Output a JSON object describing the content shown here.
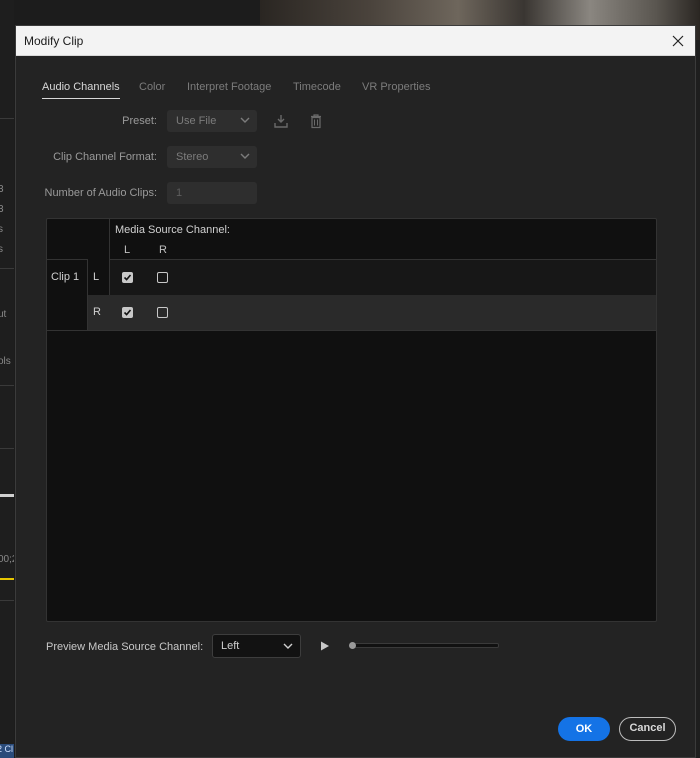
{
  "background": {
    "left_fragments": [
      "3",
      "3",
      "s",
      "s",
      "ut",
      "ols",
      "00;2",
      "2 Cl"
    ]
  },
  "dialog": {
    "title": "Modify Clip",
    "close_icon": "close-icon",
    "tabs": [
      {
        "label": "Audio Channels",
        "active": true
      },
      {
        "label": "Color",
        "active": false
      },
      {
        "label": "Interpret Footage",
        "active": false
      },
      {
        "label": "Timecode",
        "active": false
      },
      {
        "label": "VR Properties",
        "active": false
      }
    ],
    "preset": {
      "label": "Preset:",
      "value": "Use File",
      "save_icon": "save-preset-icon",
      "delete_icon": "trash-icon"
    },
    "clip_channel_format": {
      "label": "Clip Channel Format:",
      "value": "Stereo"
    },
    "num_audio_clips": {
      "label": "Number of Audio Clips:",
      "value": "1"
    },
    "matrix": {
      "header": "Media Source Channel:",
      "columns": [
        "L",
        "R"
      ],
      "clips": [
        {
          "name": "Clip 1",
          "rows": [
            {
              "channel": "L",
              "checks": [
                true,
                false
              ]
            },
            {
              "channel": "R",
              "checks": [
                true,
                false
              ]
            }
          ]
        }
      ]
    },
    "preview": {
      "label": "Preview Media Source Channel:",
      "value": "Left",
      "play_icon": "play-icon",
      "position": 0.0
    },
    "buttons": {
      "ok": "OK",
      "cancel": "Cancel"
    },
    "colors": {
      "accent": "#1473e6",
      "dialog_bg": "#232323",
      "matrix_bg": "#101010"
    }
  }
}
